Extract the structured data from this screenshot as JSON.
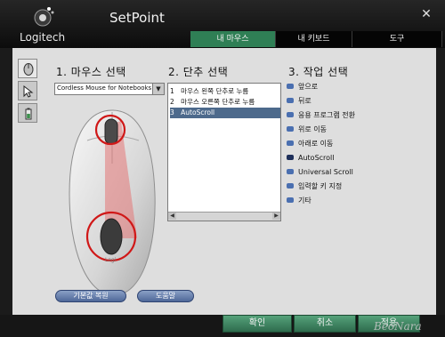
{
  "app": {
    "brand": "Logitech",
    "title": "SetPoint"
  },
  "tabs": [
    {
      "label": "내 마우스",
      "active": true
    },
    {
      "label": "내 키보드",
      "active": false
    },
    {
      "label": "도구",
      "active": false
    }
  ],
  "side_tabs": [
    {
      "icon": "mouse-icon",
      "active": true
    },
    {
      "icon": "pointer-icon",
      "active": false
    },
    {
      "icon": "battery-icon",
      "active": false
    }
  ],
  "section1": {
    "title": "1. 마우스 선택",
    "selected_mouse": "Cordless Mouse for Notebooks"
  },
  "section2": {
    "title": "2. 단추 선택",
    "buttons": [
      {
        "num": "1",
        "label": "마우스 왼쪽 단추로 누름",
        "selected": false
      },
      {
        "num": "2",
        "label": "마우스 오른쪽 단추로 누름",
        "selected": false
      },
      {
        "num": "3",
        "label": "AutoScroll",
        "selected": true
      }
    ]
  },
  "section3": {
    "title": "3. 작업 선택",
    "actions": [
      {
        "label": "앞으로",
        "selected": false
      },
      {
        "label": "뒤로",
        "selected": false
      },
      {
        "label": "응용 프로그램 전환",
        "selected": false
      },
      {
        "label": "위로 이동",
        "selected": false
      },
      {
        "label": "아래로 이동",
        "selected": false
      },
      {
        "label": "AutoScroll",
        "selected": true
      },
      {
        "label": "Universal Scroll",
        "selected": false
      },
      {
        "label": "입력할 키 지정",
        "selected": false
      },
      {
        "label": "기타",
        "selected": false
      }
    ]
  },
  "buttons": {
    "restore_defaults": "기본값 복원",
    "help": "도움말",
    "ok": "확인",
    "cancel": "취소",
    "apply": "적용"
  },
  "watermark": "BeoNara",
  "colors": {
    "accent_green": "#2f7f55",
    "selection_blue": "#4d6a8c",
    "highlight_red": "#d01818"
  }
}
